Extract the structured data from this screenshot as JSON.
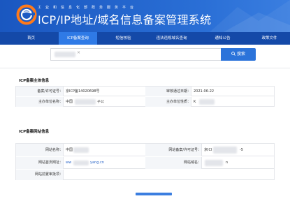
{
  "header": {
    "subtitle": "工业和信息化部政务服务平台",
    "title": "ICP/IP地址/域名信息备案管理系统"
  },
  "nav": [
    {
      "label": "首页",
      "active": false
    },
    {
      "label": "ICP备案查询",
      "active": true
    },
    {
      "label": "短信核验",
      "active": false
    },
    {
      "label": "违法违规域名查询",
      "active": false
    },
    {
      "label": "通知公告",
      "active": false
    },
    {
      "label": "政策文件",
      "active": false
    }
  ],
  "search": {
    "value": "",
    "button_label": "搜索",
    "button_icon": "search-icon"
  },
  "subject": {
    "title": "ICP备案主体信息",
    "rows": [
      {
        "l1": "备案/许可证号：",
        "v1": "京ICP备14020698号",
        "l2": "审核通过日期：",
        "v2": "2021-06-22"
      },
      {
        "l1": "主办单位名称：",
        "v1": "中国",
        "v1b": "子公",
        "l2": "主办单位性质：",
        "v2": "K"
      }
    ]
  },
  "website": {
    "title": "ICP备案网站信息",
    "rows": [
      {
        "l1": "网站名称：",
        "v1": "中国",
        "l2": "网站备案/许可证号：",
        "v2": "京ICI",
        "v2b": "-5"
      },
      {
        "l1": "网站首页网址：",
        "v1": "ww",
        "v1b": "yang.cn",
        "l2": "网站域名：",
        "v2": "n"
      },
      {
        "l1": "网站前置审批项：",
        "v1": "",
        "l2": "",
        "v2": ""
      }
    ]
  },
  "colors": {
    "header_blue": "#1d5bc4",
    "nav_blue": "#1449a8",
    "active_tab": "#2f7ae6",
    "button_blue": "#2b73da",
    "link": "#2b66c8"
  }
}
